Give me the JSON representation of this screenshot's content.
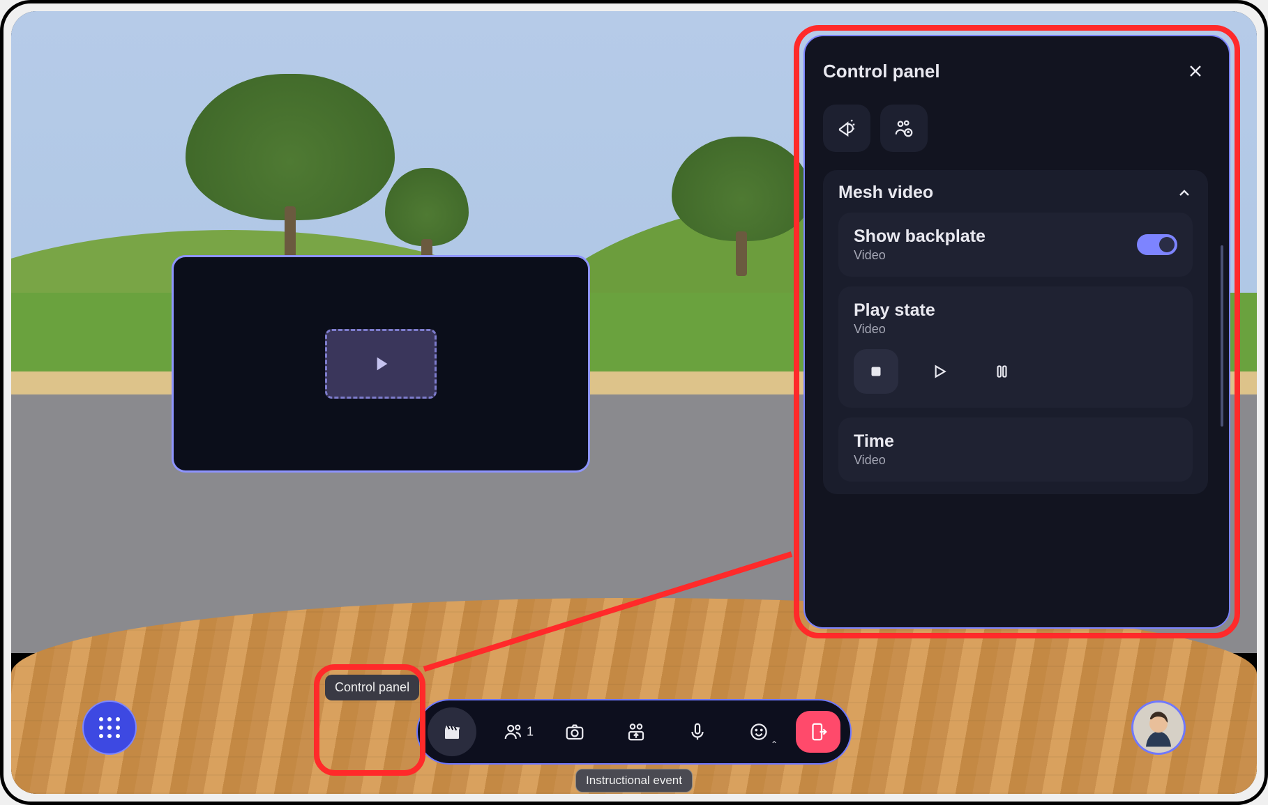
{
  "panel": {
    "title": "Control panel",
    "section": {
      "title": "Mesh video"
    },
    "backplate": {
      "label": "Show backplate",
      "sub": "Video",
      "enabled": true
    },
    "playstate": {
      "label": "Play state",
      "sub": "Video",
      "selected": "stop"
    },
    "time": {
      "label": "Time",
      "sub": "Video"
    }
  },
  "tooltip": "Control panel",
  "dock": {
    "people_count": "1",
    "label": "Instructional event"
  }
}
